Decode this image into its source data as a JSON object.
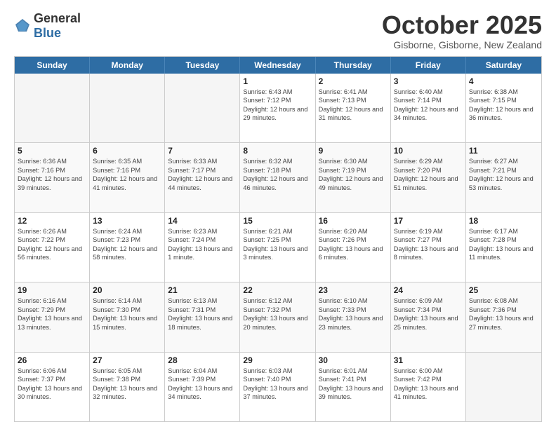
{
  "logo": {
    "general": "General",
    "blue": "Blue"
  },
  "header": {
    "month": "October 2025",
    "location": "Gisborne, Gisborne, New Zealand"
  },
  "days_of_week": [
    "Sunday",
    "Monday",
    "Tuesday",
    "Wednesday",
    "Thursday",
    "Friday",
    "Saturday"
  ],
  "weeks": [
    [
      {
        "day": "",
        "info": "",
        "empty": true
      },
      {
        "day": "",
        "info": "",
        "empty": true
      },
      {
        "day": "",
        "info": "",
        "empty": true
      },
      {
        "day": "1",
        "info": "Sunrise: 6:43 AM\nSunset: 7:12 PM\nDaylight: 12 hours and 29 minutes."
      },
      {
        "day": "2",
        "info": "Sunrise: 6:41 AM\nSunset: 7:13 PM\nDaylight: 12 hours and 31 minutes."
      },
      {
        "day": "3",
        "info": "Sunrise: 6:40 AM\nSunset: 7:14 PM\nDaylight: 12 hours and 34 minutes."
      },
      {
        "day": "4",
        "info": "Sunrise: 6:38 AM\nSunset: 7:15 PM\nDaylight: 12 hours and 36 minutes."
      }
    ],
    [
      {
        "day": "5",
        "info": "Sunrise: 6:36 AM\nSunset: 7:16 PM\nDaylight: 12 hours and 39 minutes."
      },
      {
        "day": "6",
        "info": "Sunrise: 6:35 AM\nSunset: 7:16 PM\nDaylight: 12 hours and 41 minutes."
      },
      {
        "day": "7",
        "info": "Sunrise: 6:33 AM\nSunset: 7:17 PM\nDaylight: 12 hours and 44 minutes."
      },
      {
        "day": "8",
        "info": "Sunrise: 6:32 AM\nSunset: 7:18 PM\nDaylight: 12 hours and 46 minutes."
      },
      {
        "day": "9",
        "info": "Sunrise: 6:30 AM\nSunset: 7:19 PM\nDaylight: 12 hours and 49 minutes."
      },
      {
        "day": "10",
        "info": "Sunrise: 6:29 AM\nSunset: 7:20 PM\nDaylight: 12 hours and 51 minutes."
      },
      {
        "day": "11",
        "info": "Sunrise: 6:27 AM\nSunset: 7:21 PM\nDaylight: 12 hours and 53 minutes."
      }
    ],
    [
      {
        "day": "12",
        "info": "Sunrise: 6:26 AM\nSunset: 7:22 PM\nDaylight: 12 hours and 56 minutes."
      },
      {
        "day": "13",
        "info": "Sunrise: 6:24 AM\nSunset: 7:23 PM\nDaylight: 12 hours and 58 minutes."
      },
      {
        "day": "14",
        "info": "Sunrise: 6:23 AM\nSunset: 7:24 PM\nDaylight: 13 hours and 1 minute."
      },
      {
        "day": "15",
        "info": "Sunrise: 6:21 AM\nSunset: 7:25 PM\nDaylight: 13 hours and 3 minutes."
      },
      {
        "day": "16",
        "info": "Sunrise: 6:20 AM\nSunset: 7:26 PM\nDaylight: 13 hours and 6 minutes."
      },
      {
        "day": "17",
        "info": "Sunrise: 6:19 AM\nSunset: 7:27 PM\nDaylight: 13 hours and 8 minutes."
      },
      {
        "day": "18",
        "info": "Sunrise: 6:17 AM\nSunset: 7:28 PM\nDaylight: 13 hours and 11 minutes."
      }
    ],
    [
      {
        "day": "19",
        "info": "Sunrise: 6:16 AM\nSunset: 7:29 PM\nDaylight: 13 hours and 13 minutes."
      },
      {
        "day": "20",
        "info": "Sunrise: 6:14 AM\nSunset: 7:30 PM\nDaylight: 13 hours and 15 minutes."
      },
      {
        "day": "21",
        "info": "Sunrise: 6:13 AM\nSunset: 7:31 PM\nDaylight: 13 hours and 18 minutes."
      },
      {
        "day": "22",
        "info": "Sunrise: 6:12 AM\nSunset: 7:32 PM\nDaylight: 13 hours and 20 minutes."
      },
      {
        "day": "23",
        "info": "Sunrise: 6:10 AM\nSunset: 7:33 PM\nDaylight: 13 hours and 23 minutes."
      },
      {
        "day": "24",
        "info": "Sunrise: 6:09 AM\nSunset: 7:34 PM\nDaylight: 13 hours and 25 minutes."
      },
      {
        "day": "25",
        "info": "Sunrise: 6:08 AM\nSunset: 7:36 PM\nDaylight: 13 hours and 27 minutes."
      }
    ],
    [
      {
        "day": "26",
        "info": "Sunrise: 6:06 AM\nSunset: 7:37 PM\nDaylight: 13 hours and 30 minutes."
      },
      {
        "day": "27",
        "info": "Sunrise: 6:05 AM\nSunset: 7:38 PM\nDaylight: 13 hours and 32 minutes."
      },
      {
        "day": "28",
        "info": "Sunrise: 6:04 AM\nSunset: 7:39 PM\nDaylight: 13 hours and 34 minutes."
      },
      {
        "day": "29",
        "info": "Sunrise: 6:03 AM\nSunset: 7:40 PM\nDaylight: 13 hours and 37 minutes."
      },
      {
        "day": "30",
        "info": "Sunrise: 6:01 AM\nSunset: 7:41 PM\nDaylight: 13 hours and 39 minutes."
      },
      {
        "day": "31",
        "info": "Sunrise: 6:00 AM\nSunset: 7:42 PM\nDaylight: 13 hours and 41 minutes."
      },
      {
        "day": "",
        "info": "",
        "empty": true
      }
    ]
  ]
}
